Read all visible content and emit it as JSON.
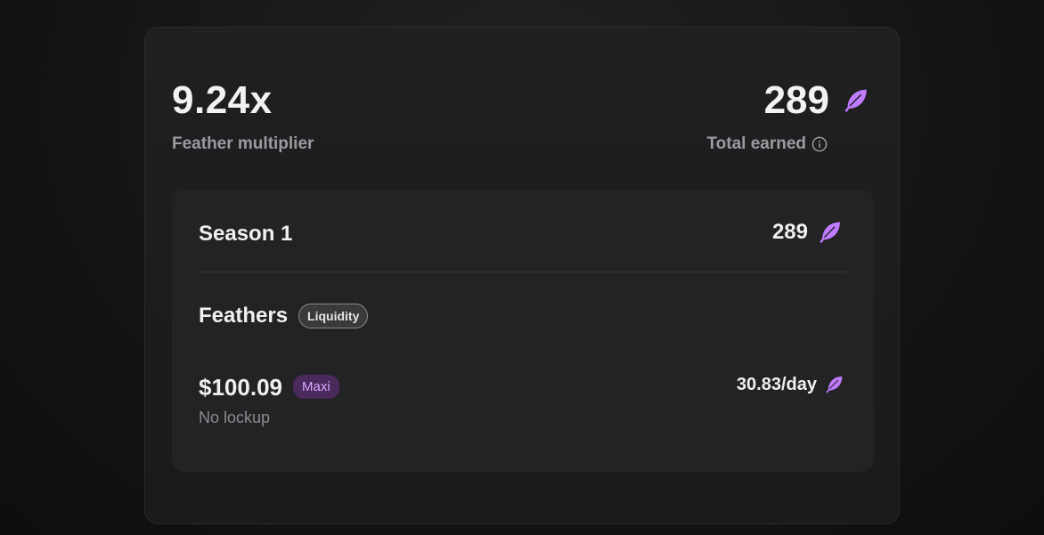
{
  "colors": {
    "accent_feather": "#c07bff",
    "maxi_badge_bg": "#4a2a5c",
    "maxi_badge_text": "#d8a8ff"
  },
  "summary": {
    "multiplier_value": "9.24x",
    "multiplier_label": "Feather multiplier",
    "total_value": "289",
    "total_label": "Total earned",
    "total_icon": "feather-icon",
    "info_icon": "info-icon"
  },
  "season": {
    "title": "Season 1",
    "value": "289",
    "icon": "feather-icon"
  },
  "feathers": {
    "title": "Feathers",
    "badge": "Liquidity",
    "position": {
      "amount": "$100.09",
      "badge": "Maxi",
      "lockup": "No lockup",
      "rate": "30.83/day",
      "icon": "feather-icon"
    }
  }
}
